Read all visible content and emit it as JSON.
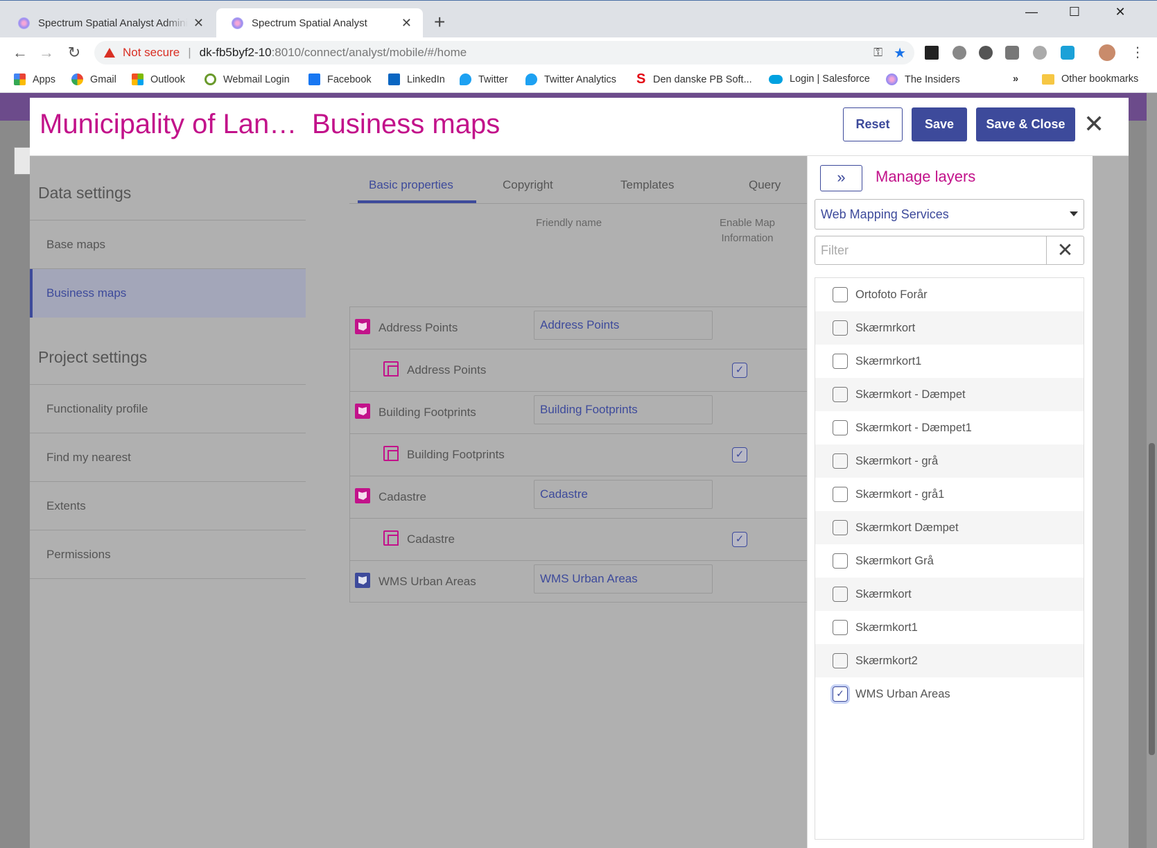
{
  "browser": {
    "tabs": [
      {
        "title": "Spectrum Spatial Analyst Adminis",
        "active": false
      },
      {
        "title": "Spectrum Spatial Analyst",
        "active": true
      }
    ],
    "new_tab": "+",
    "window_controls": {
      "minimize": "—",
      "maximize": "☐",
      "close": "✕"
    },
    "nav": {
      "back": "←",
      "forward": "→",
      "reload": "↻"
    },
    "omnibox": {
      "security_label": "Not secure",
      "separator": "|",
      "host": "dk-fb5byf2-10",
      "rest": ":8010/connect/analyst/mobile/#/home"
    },
    "bookmarks": [
      {
        "label": "Apps",
        "icon": "apps-grid-icon",
        "color": "#e94235"
      },
      {
        "label": "Gmail",
        "icon": "google-icon",
        "color": "#4285f4"
      },
      {
        "label": "Outlook",
        "icon": "microsoft-icon",
        "color": "#f25022"
      },
      {
        "label": "Webmail Login",
        "icon": "webmail-icon",
        "color": "#6a9a2c"
      },
      {
        "label": "Facebook",
        "icon": "facebook-icon",
        "color": "#1877f2"
      },
      {
        "label": "LinkedIn",
        "icon": "linkedin-icon",
        "color": "#0a66c2"
      },
      {
        "label": "Twitter",
        "icon": "twitter-icon",
        "color": "#1da1f2"
      },
      {
        "label": "Twitter Analytics",
        "icon": "twitter-icon",
        "color": "#1da1f2"
      },
      {
        "label": "Den danske PB Soft...",
        "icon": "s-logo-icon",
        "color": "#e30613"
      },
      {
        "label": "Login | Salesforce",
        "icon": "salesforce-icon",
        "color": "#00a1e0"
      },
      {
        "label": "The Insiders",
        "icon": "insiders-icon",
        "color": "#9a8cf0"
      }
    ],
    "bookmarks_overflow": "»",
    "other_bookmarks": "Other bookmarks"
  },
  "header": {
    "project_title": "Municipality of Lan…",
    "page_title": "Business maps",
    "reset_label": "Reset",
    "save_label": "Save",
    "save_close_label": "Save & Close",
    "close_glyph": "✕"
  },
  "sidebar": {
    "data_settings_heading": "Data settings",
    "data_items": [
      {
        "label": "Base maps",
        "active": false
      },
      {
        "label": "Business maps",
        "active": true
      }
    ],
    "project_settings_heading": "Project settings",
    "project_items": [
      {
        "label": "Functionality profile"
      },
      {
        "label": "Find my nearest"
      },
      {
        "label": "Extents"
      },
      {
        "label": "Permissions"
      }
    ]
  },
  "content": {
    "tabs": [
      {
        "label": "Basic properties",
        "active": true
      },
      {
        "label": "Copyright",
        "active": false
      },
      {
        "label": "Templates",
        "active": false
      },
      {
        "label": "Query",
        "active": false
      }
    ],
    "columns": {
      "friendly_name": "Friendly name",
      "enable_map_info_line1": "Enable Map",
      "enable_map_info_line2": "Information"
    },
    "layers": [
      {
        "type": "service",
        "name": "Address Points",
        "friendly_name": "Address Points"
      },
      {
        "type": "sublayer",
        "name": "Address Points",
        "enable_map_information": true
      },
      {
        "type": "service",
        "name": "Building Footprints",
        "friendly_name": "Building Footprints"
      },
      {
        "type": "sublayer",
        "name": "Building Footprints",
        "enable_map_information": true
      },
      {
        "type": "service",
        "name": "Cadastre",
        "friendly_name": "Cadastre"
      },
      {
        "type": "sublayer",
        "name": "Cadastre",
        "enable_map_information": true
      },
      {
        "type": "wms",
        "name": "WMS Urban Areas",
        "friendly_name": "WMS Urban Areas"
      }
    ]
  },
  "manage_layers": {
    "collapse_glyph": "»",
    "title": "Manage layers",
    "source_select": "Web Mapping Services",
    "filter_placeholder": "Filter",
    "filter_clear_glyph": "✕",
    "items": [
      {
        "label": "Ortofoto Forår",
        "checked": false
      },
      {
        "label": "Skærmrkort",
        "checked": false
      },
      {
        "label": "Skærmrkort1",
        "checked": false
      },
      {
        "label": "Skærmkort - Dæmpet",
        "checked": false
      },
      {
        "label": "Skærmkort - Dæmpet1",
        "checked": false
      },
      {
        "label": "Skærmkort - grå",
        "checked": false
      },
      {
        "label": "Skærmkort - grå1",
        "checked": false
      },
      {
        "label": "Skærmkort Dæmpet",
        "checked": false
      },
      {
        "label": "Skærmkort Grå",
        "checked": false
      },
      {
        "label": "Skærmkort",
        "checked": false
      },
      {
        "label": "Skærmkort1",
        "checked": false
      },
      {
        "label": "Skærmkort2",
        "checked": false
      },
      {
        "label": "WMS Urban Areas",
        "checked": true
      }
    ]
  },
  "colors": {
    "brand_magenta": "#c2128a",
    "primary_blue": "#3d4a9b",
    "overlay_grey": "#b0b0b0"
  }
}
